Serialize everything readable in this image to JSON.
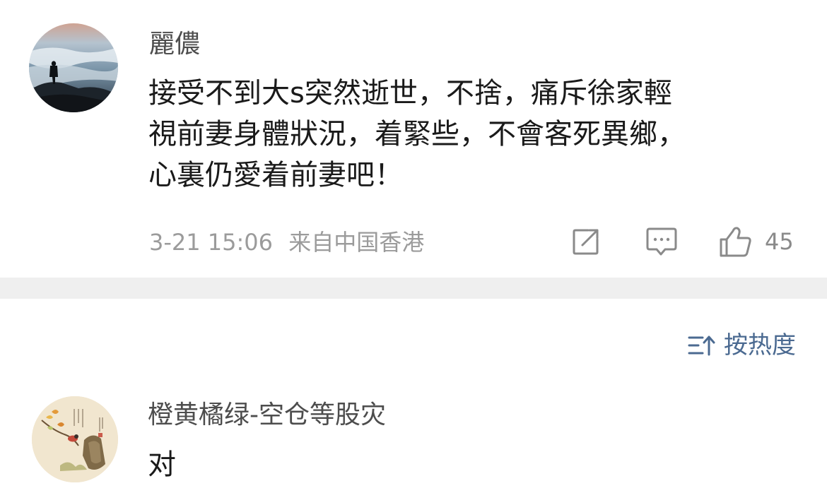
{
  "post": {
    "author": "麗儂",
    "body_lines": [
      "接受不到大s突然逝世，不捨，痛斥徐家輕",
      "視前妻身體狀況，着緊些，不會客死異鄉，",
      "心裏仍愛着前妻吧！"
    ],
    "timestamp": "3-21 15:06",
    "location": "来自中国香港",
    "like_count": "45",
    "icons": {
      "avatar": "misty-mountain-avatar",
      "share": "share-icon",
      "comment": "comment-icon",
      "like": "thumbs-up-icon"
    }
  },
  "sort": {
    "label": "按热度",
    "icon": "sort-icon"
  },
  "comments": [
    {
      "author": "橙黄橘绿-空仓等股灾",
      "text": "对",
      "avatar": "painting-avatar"
    }
  ],
  "colors": {
    "name": "#4d4d4d",
    "text": "#1a1a1a",
    "meta": "#9b9b9b",
    "link": "#4b6a91",
    "divider": "#efefef"
  }
}
